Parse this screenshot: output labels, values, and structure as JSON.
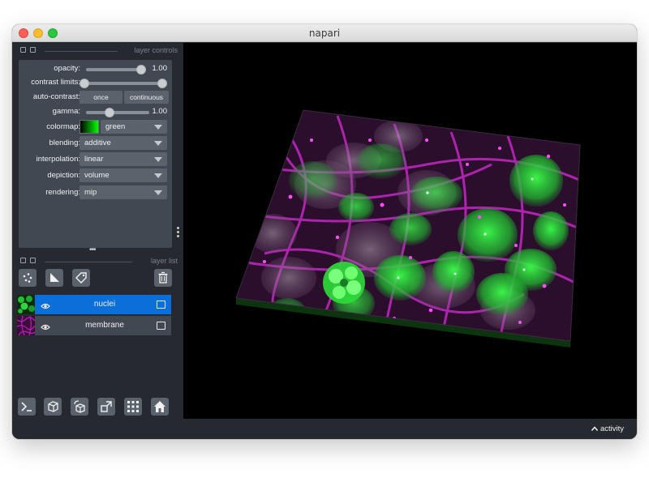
{
  "window": {
    "title": "napari"
  },
  "layer_controls": {
    "header": "layer controls",
    "opacity": {
      "label": "opacity:",
      "value": "1.00",
      "level": 1.0
    },
    "contrast_limits": {
      "label": "contrast limits:",
      "low": 0.0,
      "high": 1.0
    },
    "auto_contrast": {
      "label": "auto-contrast:",
      "once": "once",
      "continuous": "continuous"
    },
    "gamma": {
      "label": "gamma:",
      "value": "1.00",
      "level": 0.35
    },
    "colormap": {
      "label": "colormap:",
      "value": "green",
      "swatch": "#00ff00"
    },
    "blending": {
      "label": "blending:",
      "value": "additive"
    },
    "interpolation": {
      "label": "interpolation:",
      "value": "linear"
    },
    "depiction": {
      "label": "depiction:",
      "value": "volume"
    },
    "rendering": {
      "label": "rendering:",
      "value": "mip"
    }
  },
  "layer_list": {
    "header": "layer list",
    "tools": [
      "new-points-icon",
      "new-shapes-icon",
      "new-labels-icon",
      "delete-icon"
    ],
    "layers": [
      {
        "name": "nuclei",
        "selected": true,
        "visible": true,
        "thumb_color": "#22c435"
      },
      {
        "name": "membrane",
        "selected": false,
        "visible": true,
        "thumb_color": "#b31fb3"
      }
    ]
  },
  "bottom_bar": [
    "console-icon",
    "ndisplay-icon",
    "roll-icon",
    "transpose-icon",
    "grid-icon",
    "home-icon"
  ],
  "status": {
    "activity": "activity"
  },
  "colors": {
    "background": "#262930",
    "panel": "#414851",
    "button": "#5a626c",
    "selection": "#0a6fd9",
    "nuclei": "#33ff33",
    "membrane": "#ff33ff"
  }
}
